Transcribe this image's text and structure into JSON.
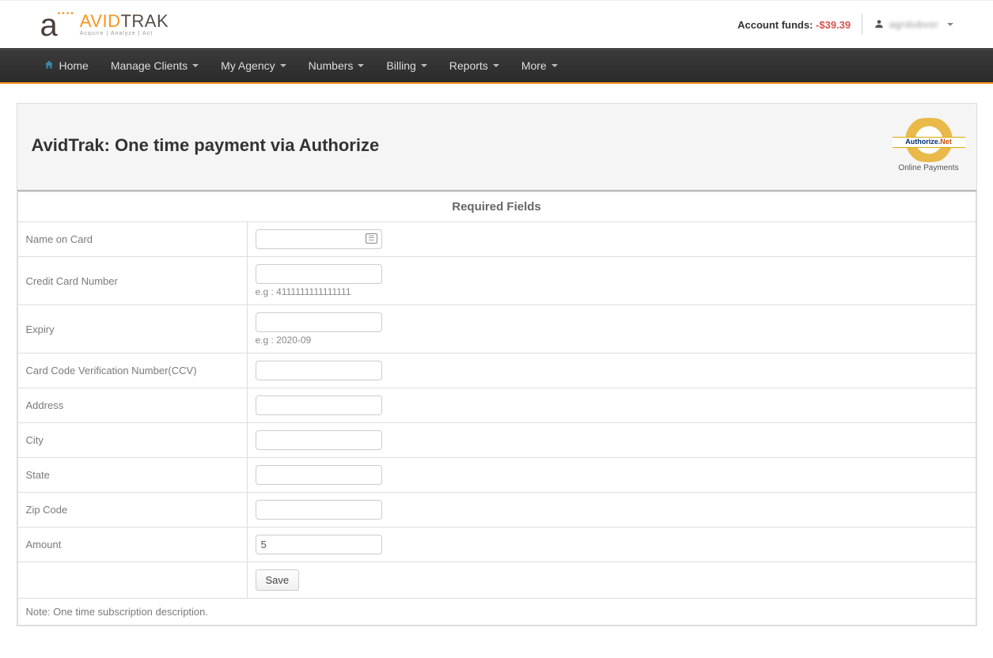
{
  "brand": {
    "mark": "a",
    "name_part1": "AVID",
    "name_part2": "TRAK",
    "tagline": "Acquire | Analyze | Act"
  },
  "header": {
    "funds_label": "Account funds: ",
    "funds_amount": "-$39.39",
    "user_name": "agrdubvsr"
  },
  "nav": {
    "home": "Home",
    "manage_clients": "Manage Clients",
    "my_agency": "My Agency",
    "numbers": "Numbers",
    "billing": "Billing",
    "reports": "Reports",
    "more": "More"
  },
  "panel": {
    "title": "AvidTrak: One time payment via Authorize",
    "seal_brand1": "Authorize.",
    "seal_brand2": "Net",
    "seal_caption": "Online Payments"
  },
  "form": {
    "section_title": "Required Fields",
    "name_label": "Name on Card",
    "name_value": "",
    "cc_label": "Credit Card Number",
    "cc_value": "",
    "cc_hint": "e.g : 4111111111111111",
    "expiry_label": "Expiry",
    "expiry_value": "",
    "expiry_hint": "e.g : 2020-09",
    "ccv_label": "Card Code Verification Number(CCV)",
    "ccv_value": "",
    "address_label": "Address",
    "address_value": "",
    "city_label": "City",
    "city_value": "",
    "state_label": "State",
    "state_value": "",
    "zip_label": "Zip Code",
    "zip_value": "",
    "amount_label": "Amount",
    "amount_value": "5",
    "save_label": "Save",
    "note": "Note: One time subscription description."
  }
}
